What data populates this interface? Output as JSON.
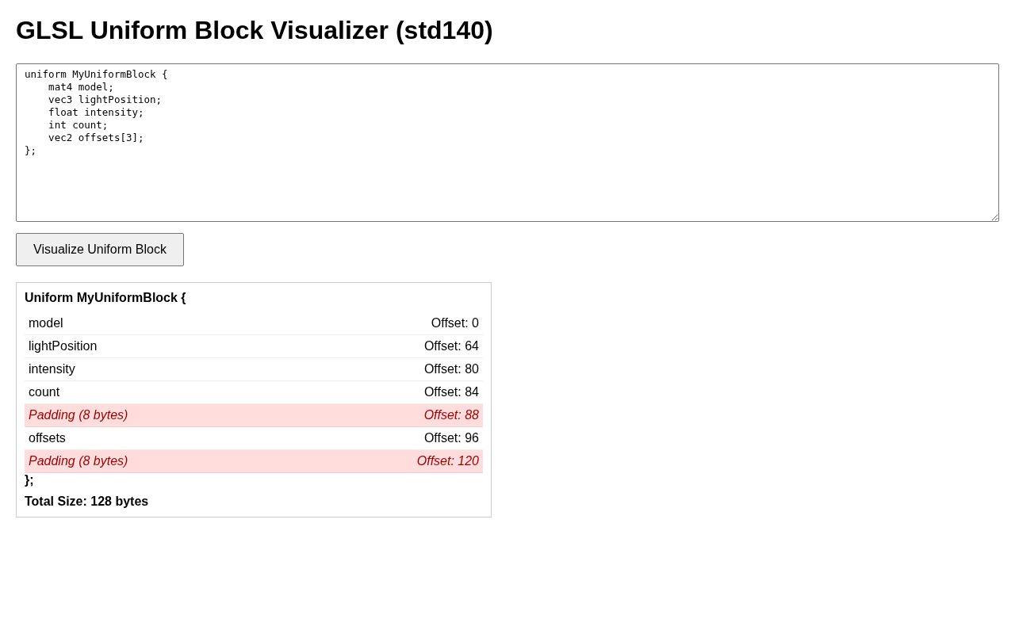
{
  "title": "GLSL Uniform Block Visualizer (std140)",
  "editor": {
    "value": "uniform MyUniformBlock {\n    mat4 model;\n    vec3 lightPosition;\n    float intensity;\n    int count;\n    vec2 offsets[3];\n};"
  },
  "visualize_button": {
    "label": "Visualize Uniform Block"
  },
  "layout": {
    "header": "Uniform MyUniformBlock {",
    "rows": [
      {
        "kind": "member",
        "name": "model",
        "offset": "Offset: 0"
      },
      {
        "kind": "member",
        "name": "lightPosition",
        "offset": "Offset: 64"
      },
      {
        "kind": "member",
        "name": "intensity",
        "offset": "Offset: 80"
      },
      {
        "kind": "member",
        "name": "count",
        "offset": "Offset: 84"
      },
      {
        "kind": "padding",
        "name": "Padding (8 bytes)",
        "offset": "Offset: 88"
      },
      {
        "kind": "member",
        "name": "offsets",
        "offset": "Offset: 96"
      },
      {
        "kind": "padding",
        "name": "Padding (8 bytes)",
        "offset": "Offset: 120"
      }
    ],
    "closing": "};",
    "total": "Total Size: 128 bytes"
  }
}
